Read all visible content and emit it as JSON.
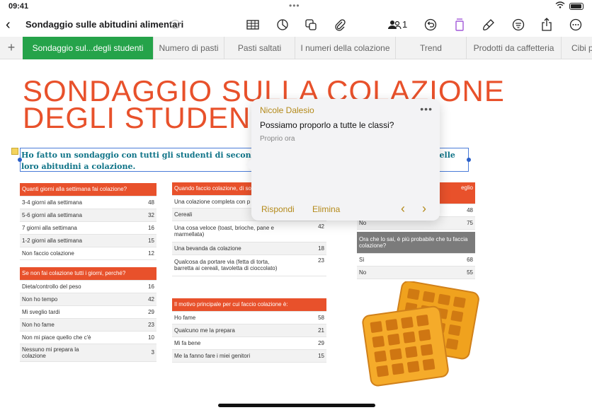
{
  "status": {
    "time": "09:41",
    "dots": "•••"
  },
  "toolbar": {
    "doc_title": "Sondaggio sulle abitudini alimentari",
    "collab_count": "1"
  },
  "tabs": [
    {
      "label": "Sondaggio sul...degli studenti"
    },
    {
      "label": "Numero di pasti"
    },
    {
      "label": "Pasti saltati"
    },
    {
      "label": "I numeri della colazione"
    },
    {
      "label": "Trend"
    },
    {
      "label": "Prodotti da caffetteria"
    },
    {
      "label": "Cibi p"
    }
  ],
  "title": {
    "line1": "SONDAGGIO SULLA COLAZIONE",
    "line2": "DEGLI STUDENTI"
  },
  "intro": "Ho fatto un sondaggio con tutti gli studenti di seconda media per approfondire la conoscenza delle loro abitudini a colazione.",
  "table1": {
    "header": "Quanti giorni alla settimana fai colazione?",
    "rows": [
      {
        "label": "3-4 giorni alla settimana",
        "value": "48"
      },
      {
        "label": "5-6 giorni alla settimana",
        "value": "32"
      },
      {
        "label": "7 giorni alla settimana",
        "value": "16"
      },
      {
        "label": "1-2 giorni alla settimana",
        "value": "15"
      },
      {
        "label": "Non faccio colazione",
        "value": "12"
      }
    ]
  },
  "table2": {
    "header": "Se non fai colazione tutti i giorni, perché?",
    "rows": [
      {
        "label": "Dieta/controllo del peso",
        "value": "16"
      },
      {
        "label": "Non ho tempo",
        "value": "42"
      },
      {
        "label": "Mi sveglio tardi",
        "value": "29"
      },
      {
        "label": "Non ho fame",
        "value": "23"
      },
      {
        "label": "Non mi piace quello che c'è",
        "value": "10"
      },
      {
        "label": "Nessuno mi prepara la colazione",
        "value": "3"
      }
    ]
  },
  "table3": {
    "header": "Quando faccio colazione, di so",
    "rows": [
      {
        "label": "Una colazione completa con p",
        "value": ""
      },
      {
        "label": "Cereali",
        "value": ""
      },
      {
        "label": "Una cosa veloce (toast, brioche, pane e marmellata)",
        "value": "42"
      },
      {
        "label": "Una bevanda da colazione",
        "value": "18"
      },
      {
        "label": "Qualcosa da portare via (fetta di torta, barretta ai cereali, tavoletta di cioccolato)",
        "value": "23"
      }
    ]
  },
  "table4": {
    "header": "Il motivo principale per cui faccio colazione è:",
    "rows": [
      {
        "label": "Ho fame",
        "value": "58"
      },
      {
        "label": "Qualcuno me la prepara",
        "value": "21"
      },
      {
        "label": "Mi fa bene",
        "value": "29"
      },
      {
        "label": "Me la fanno fare i miei genitori",
        "value": "15"
      }
    ]
  },
  "table5": {
    "header_tail": "eglio",
    "rows": [
      {
        "label": "",
        "value": "48"
      },
      {
        "label": "No",
        "value": "75"
      }
    ]
  },
  "table6": {
    "header": "Ora che lo sai, è più probabile che tu faccia colazione?",
    "rows": [
      {
        "label": "Sì",
        "value": "68"
      },
      {
        "label": "No",
        "value": "55"
      }
    ]
  },
  "comment": {
    "author": "Nicole Dalesio",
    "text": "Possiamo proporlo a tutte le classi?",
    "time": "Proprio ora",
    "reply": "Rispondi",
    "delete": "Elimina"
  },
  "colors": {
    "accent": "#e8512b",
    "tab_active": "#25a34a",
    "comment_accent": "#b48a1a",
    "intro": "#0e7387"
  }
}
